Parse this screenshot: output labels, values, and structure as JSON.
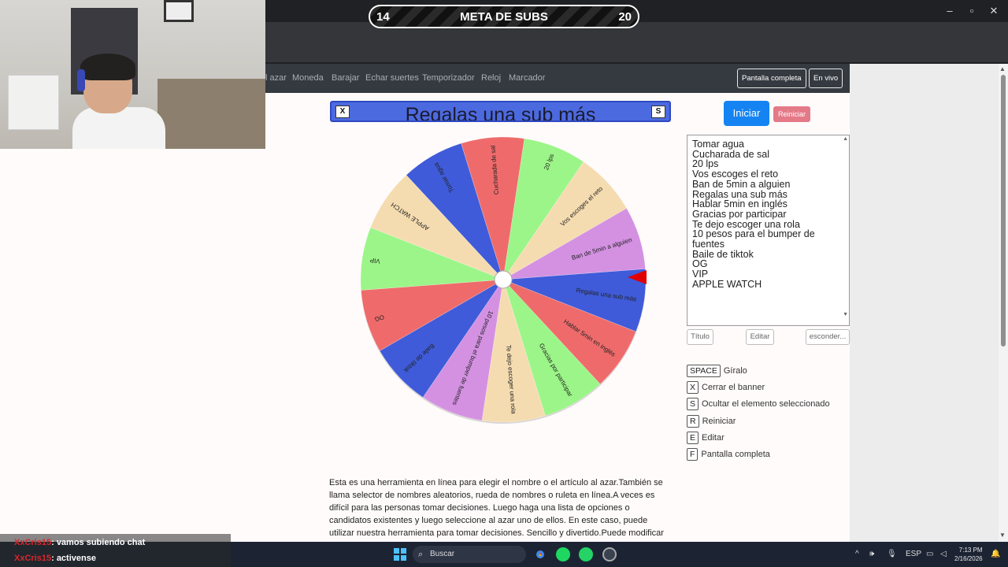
{
  "stream_overlay": {
    "goal_current": "14",
    "goal_title": "META DE SUBS",
    "goal_target": "20"
  },
  "navbar": {
    "links": [
      "l azar",
      "Moneda",
      "Barajar",
      "Echar suertes",
      "Temporizador",
      "Reloj",
      "Marcador"
    ],
    "fullscreen_button": "Pantalla completa",
    "live_button": "En vivo"
  },
  "banner": {
    "title": "Regalas una sub más",
    "close_key": "X",
    "hide_key": "S"
  },
  "wheel": {
    "segments": [
      {
        "label": "Tomar agua",
        "color": "#3f5bd9"
      },
      {
        "label": "Cucharada de sal",
        "color": "#ef6b6b"
      },
      {
        "label": "20 lps",
        "color": "#9cf588"
      },
      {
        "label": "Vos escoges el reto",
        "color": "#f5dcb0"
      },
      {
        "label": "Ban de 5min a alguien",
        "color": "#d491e2"
      },
      {
        "label": "Regalas una sub más",
        "color": "#3f5bd9"
      },
      {
        "label": "Hablar 5min en inglés",
        "color": "#ef6b6b"
      },
      {
        "label": "Gracias por participar",
        "color": "#9cf588"
      },
      {
        "label": "Te dejo escoger una rola",
        "color": "#f5dcb0"
      },
      {
        "label": "10 pesos para el bumper de fuentes",
        "color": "#d491e2"
      },
      {
        "label": "Baile de tiktok",
        "color": "#3f5bd9"
      },
      {
        "label": "OG",
        "color": "#ef6b6b"
      },
      {
        "label": "VIP",
        "color": "#9cf588"
      },
      {
        "label": "APPLE WATCH",
        "color": "#f5dcb0"
      }
    ]
  },
  "controls": {
    "start_label": "Iniciar",
    "reset_label": "Reiniciar",
    "entries": [
      "Tomar agua",
      "Cucharada de sal",
      "20 lps",
      "Vos escoges el reto",
      "Ban de 5min a alguien",
      "Regalas una sub más",
      "Hablar 5min en inglés",
      "Gracias por participar",
      "Te dejo escoger una rola",
      "10 pesos para el bumper de fuentes",
      "Baile de tiktok",
      "OG",
      "VIP",
      "APPLE WATCH"
    ],
    "title_button": "Título",
    "edit_button": "Editar",
    "hide_button": "esconder..."
  },
  "shortcuts": [
    {
      "key": "SPACE",
      "label": "Gíralo"
    },
    {
      "key": "X",
      "label": "Cerrar el banner"
    },
    {
      "key": "S",
      "label": "Ocultar el elemento seleccionado"
    },
    {
      "key": "R",
      "label": "Reiniciar"
    },
    {
      "key": "E",
      "label": "Editar"
    },
    {
      "key": "F",
      "label": "Pantalla completa"
    }
  ],
  "description": "Esta es una herramienta en línea para elegir el nombre o el artículo al azar.También se llama selector de nombres aleatorios, rueda de nombres o ruleta en línea.A veces es difícil para las personas tomar decisiones. Luego haga una lista de opciones o candidatos existentes y luego seleccione al azar uno de ellos. En este caso, puede utilizar nuestra herramienta para tomar decisiones. Sencillo y divertido.Puede modificar los nombres en textarea, poner un",
  "chat": [
    {
      "user": "XxCris15",
      "message": ": vamos subiendo chat"
    },
    {
      "user": "XxCris15",
      "message": ": activense"
    }
  ],
  "taskbar": {
    "search_placeholder": "Buscar",
    "language": "ESP",
    "time": "7:13 PM",
    "date": "2/16/2026"
  }
}
